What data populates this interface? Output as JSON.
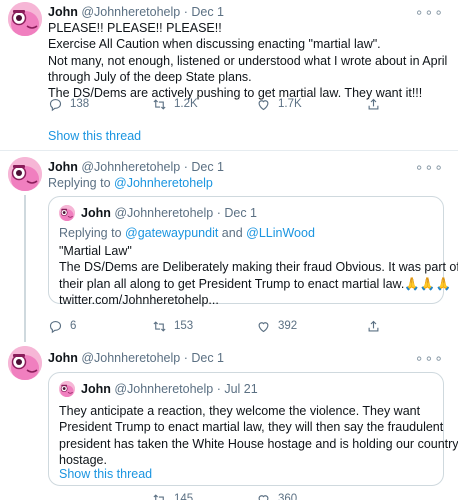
{
  "tweet1": {
    "name": "John",
    "handle": "@Johnheretohelp",
    "dot": "·",
    "date": "Dec 1",
    "lines": [
      "PLEASE!! PLEASE!! PLEASE!!",
      "Exercise All Caution when discussing enacting \"martial law\".",
      "Not many, not enough, listened or understood what I wrote about in April",
      "through July of the deep State plans.",
      "The DS/Dems are actively pushing to get martial law. They want it!!!"
    ],
    "replies": "138",
    "retweets": "1.2K",
    "likes": "1.7K",
    "show_thread": "Show this thread"
  },
  "tweet2": {
    "name": "John",
    "handle": "@Johnheretohelp",
    "dot": "·",
    "date": "Dec 1",
    "replying_prefix": "Replying to ",
    "replying_to": "@Johnheretohelp",
    "quote": {
      "name": "John",
      "handle": "@Johnheretohelp",
      "dot": "·",
      "date": "Dec 1",
      "replying_prefix": "Replying to ",
      "replying_to_1": "@gatewaypundit",
      "replying_and": " and ",
      "replying_to_2": "@LLinWood",
      "lines": [
        "\"Martial Law\"",
        "The DS/Dems are Deliberately making their fraud Obvious. It was part of",
        "their plan all along to get President Trump to enact martial law.🙏🙏🙏",
        "twitter.com/Johnheretohelp..."
      ]
    },
    "replies": "6",
    "retweets": "153",
    "likes": "392"
  },
  "tweet3": {
    "name": "John",
    "handle": "@Johnheretohelp",
    "dot": "·",
    "date": "Dec 1",
    "quote": {
      "name": "John",
      "handle": "@Johnheretohelp",
      "dot": "·",
      "date": "Jul 21",
      "lines": [
        "They anticipate a reaction, they welcome the violence. They want",
        "President Trump to enact martial law, they will then say the fraudulent",
        "president has taken the White House hostage and is holding our country",
        "hostage."
      ],
      "show_thread": "Show this thread"
    },
    "retweets": "145",
    "likes": "360"
  },
  "more_glyph": "∘∘∘",
  "icons": {
    "reply": "reply-icon",
    "retweet": "retweet-icon",
    "like": "heart-icon",
    "share": "share-icon",
    "more": "more-icon"
  },
  "colors": {
    "link": "#1b95e0",
    "muted": "#5b7083",
    "avatar": "#f6b6d6"
  }
}
